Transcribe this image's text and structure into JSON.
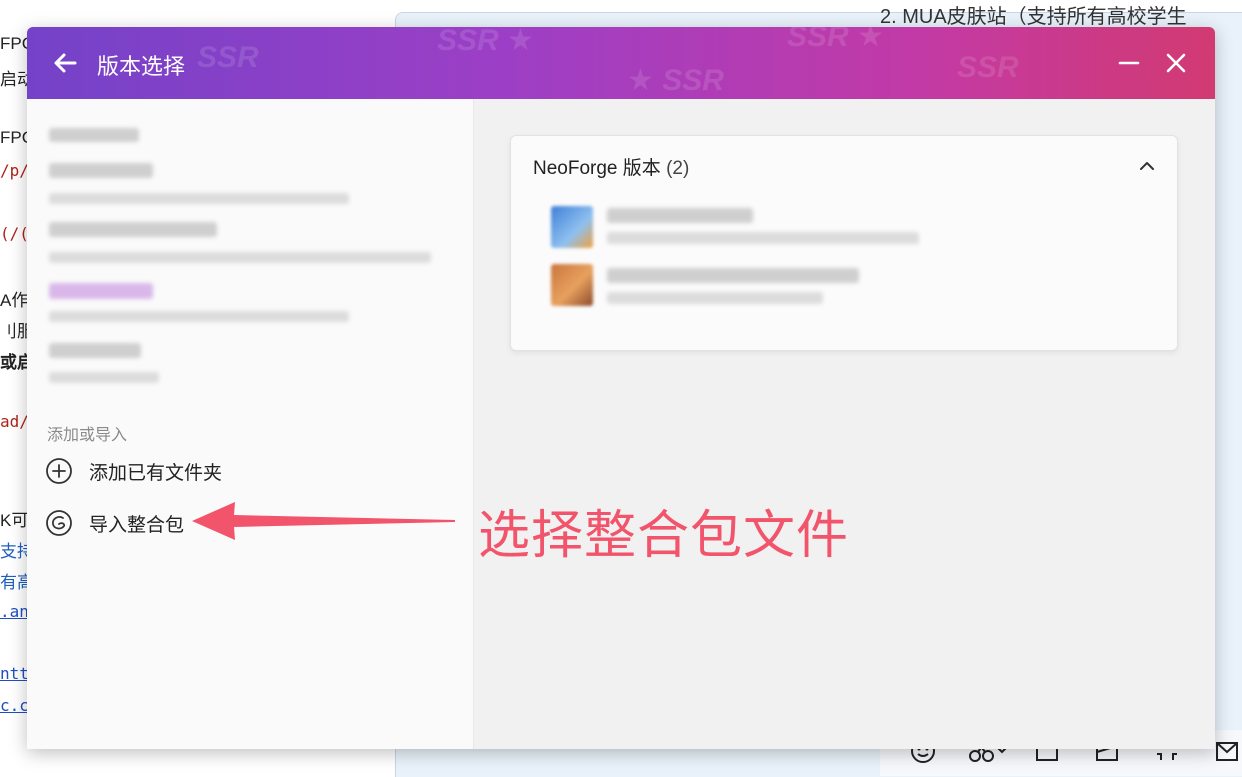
{
  "background": {
    "left_text_fragments": [
      "FPC",
      "启动",
      "FPC",
      "/p/",
      "(/(",
      "A作",
      "刂服",
      "或启",
      "ad/",
      "K可",
      "支持",
      "有高",
      ".an",
      "ntt",
      "c.c"
    ],
    "top_right_text": "2. MUA皮肤站（支持所有高校学生"
  },
  "dialog": {
    "title": "版本选择",
    "back_icon": "arrow-left-icon",
    "minimize_icon": "minimize-icon",
    "close_icon": "close-icon"
  },
  "sidebar": {
    "section_label": "添加或导入",
    "actions": [
      {
        "label": "添加已有文件夹",
        "icon": "add-circle-icon"
      },
      {
        "label": "导入整合包",
        "icon": "import-package-icon"
      }
    ]
  },
  "versions_card": {
    "title": "NeoForge 版本",
    "count": "(2)",
    "collapse_icon": "chevron-up-icon"
  },
  "annotation": {
    "text": "选择整合包文件",
    "color": "#f2546b"
  },
  "colors": {
    "title_gradient_start": "#7442c8",
    "title_gradient_end": "#d23a72",
    "annotation": "#f2546b"
  }
}
